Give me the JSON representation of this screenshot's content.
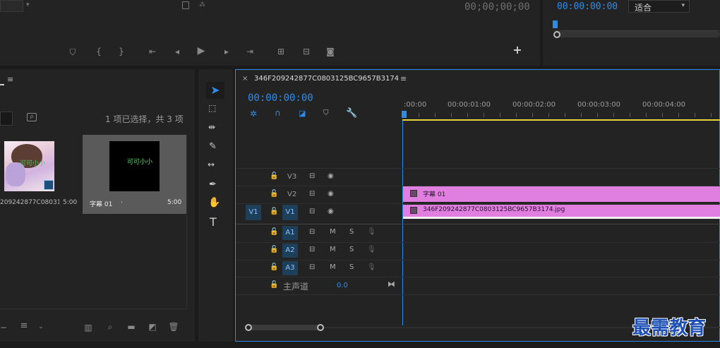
{
  "program_monitor": {
    "timecode": "00;00;00;00"
  },
  "source_monitor": {
    "timecode": "00:00:00:00",
    "zoom_select": "适合"
  },
  "project": {
    "selection_status": "1 项已选择，共 3 项",
    "items": [
      {
        "name": "209242877C08031...",
        "duration": "5:00"
      },
      {
        "name": "字幕 01",
        "duration": "5:00",
        "overlay_text": "可可小小",
        "dots": "."
      }
    ],
    "thumb1_text": "可可小小"
  },
  "timeline": {
    "tab_title": "346F209242877C0803125BC9657B3174",
    "timecode": "00:00:00:00",
    "ruler_labels": [
      ":00:00",
      "00:00:01:00",
      "00:00:02:00",
      "00:00:03:00",
      "00:00:04:00"
    ],
    "tracks": {
      "v3": "V3",
      "v2": "V2",
      "v1": "V1",
      "v1_source": "V1",
      "a1": "A1",
      "a2": "A2",
      "a3": "A3",
      "mute": "M",
      "solo": "S",
      "master_label": "主声道",
      "master_value": "0.0"
    },
    "clips": {
      "v2_name": "字幕 01",
      "v1_name": "346F209242877C0803125BC9657B3174.jpg"
    }
  },
  "watermark": "最需教育",
  "colors": {
    "accent": "#2d8ceb",
    "clip_pink": "#e07fe0",
    "workarea_yellow": "#e6d43a"
  }
}
